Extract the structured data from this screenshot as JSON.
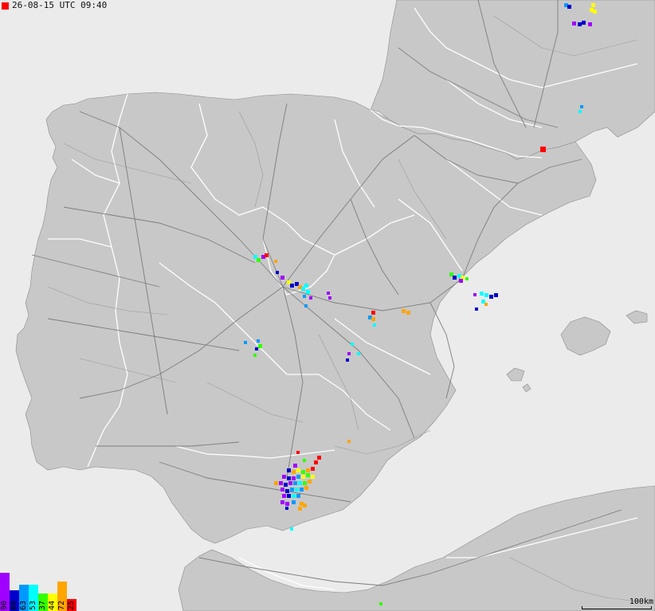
{
  "header": {
    "timestamp": "26-08-15 UTC 09:40"
  },
  "legend": {
    "items": [
      {
        "label": "90",
        "color": "#a000ff",
        "level": 1.0
      },
      {
        "label": "80",
        "color": "#0000cc",
        "level": 0.55
      },
      {
        "label": "63",
        "color": "#0099ff",
        "level": 0.68
      },
      {
        "label": "53",
        "color": "#00ffff",
        "level": 0.68
      },
      {
        "label": "37",
        "color": "#33ff00",
        "level": 0.45
      },
      {
        "label": "44",
        "color": "#ffff00",
        "level": 0.45
      },
      {
        "label": "72",
        "color": "#ffa500",
        "level": 0.78
      },
      {
        "label": "25",
        "color": "#ff0000",
        "level": 0.32
      }
    ]
  },
  "scale": {
    "label": "100km"
  },
  "map": {
    "land_color": "#c8c8c8",
    "sea_color": "#ebebeb",
    "border_color": "#ffffff",
    "road_color": "#8a8a8a"
  }
}
